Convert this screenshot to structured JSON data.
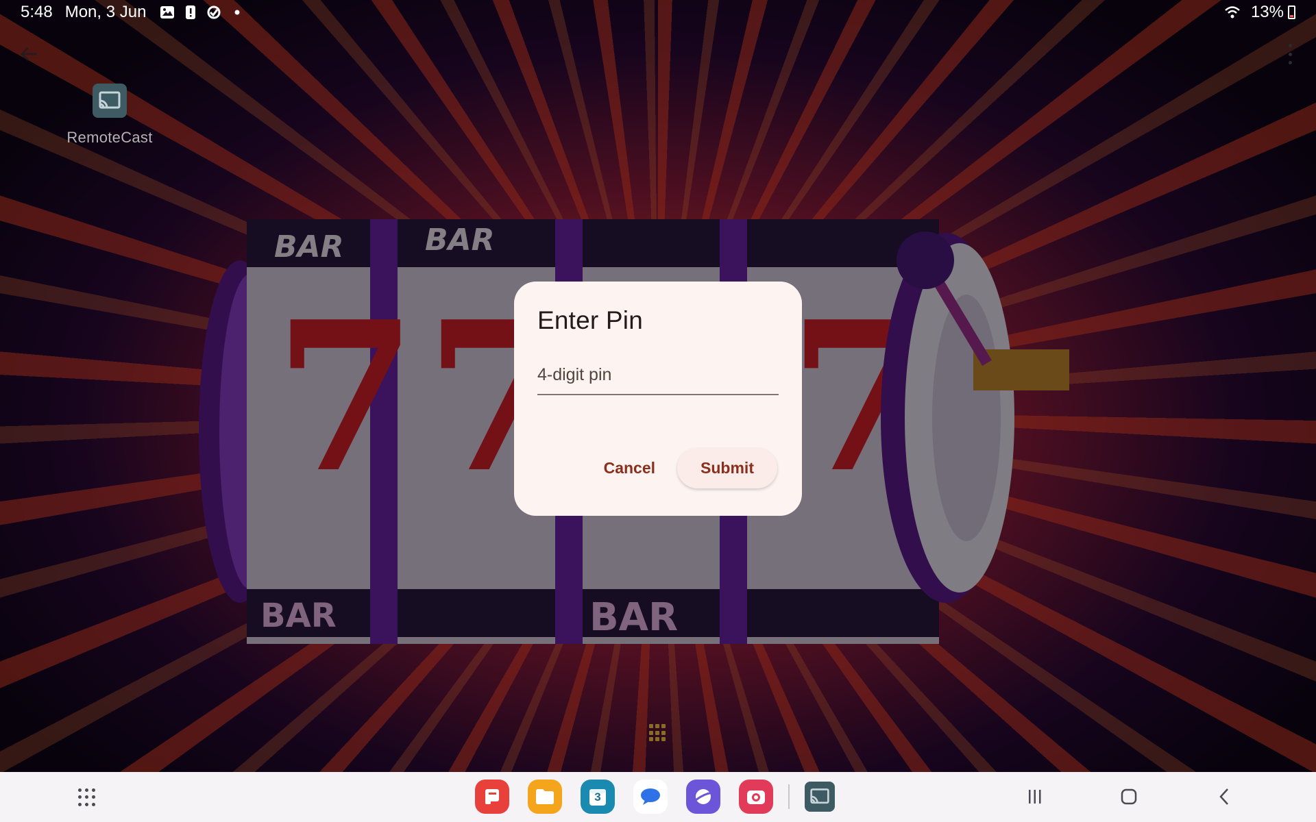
{
  "status_bar": {
    "time": "5:48",
    "date": "Mon, 3 Jun",
    "battery": "13%",
    "icons": [
      "gallery-icon",
      "alert-icon",
      "sync-icon",
      "dot-icon",
      "wifi-icon",
      "battery-icon"
    ]
  },
  "app": {
    "name": "RemoteCast",
    "icon": "cast-icon"
  },
  "dialog": {
    "title": "Enter Pin",
    "pin_placeholder": "4-digit pin",
    "pin_value": "",
    "cancel_label": "Cancel",
    "submit_label": "Submit"
  },
  "wallpaper": {
    "reel_texts": [
      "BAR",
      "BAR",
      "BAR",
      "BAR"
    ],
    "reel_sevens": [
      "7",
      "7",
      "7"
    ]
  },
  "taskbar": {
    "dock_apps": [
      {
        "name": "Flipboard-style app",
        "icon": "notes-icon",
        "color": "#e8403a"
      },
      {
        "name": "My Files",
        "icon": "folder-icon",
        "color": "#f5a51c"
      },
      {
        "name": "Calendar",
        "icon": "calendar-icon",
        "color": "#1b8ab1",
        "badge": "3"
      },
      {
        "name": "Messages",
        "icon": "messages-icon",
        "color": "#2f72e8"
      },
      {
        "name": "Internet",
        "icon": "browser-icon",
        "color": "#6c55d9"
      },
      {
        "name": "Camera",
        "icon": "camera-icon",
        "color": "#e23b5a"
      },
      {
        "name": "RemoteCast",
        "icon": "cast-icon",
        "color": "#3e5a62"
      }
    ],
    "nav": [
      "recents-icon",
      "home-icon",
      "back-icon"
    ]
  },
  "colors": {
    "dialog_bg": "#fdf3f1",
    "accent": "#8a2f1c",
    "taskbar_bg": "#f6f3f6"
  }
}
